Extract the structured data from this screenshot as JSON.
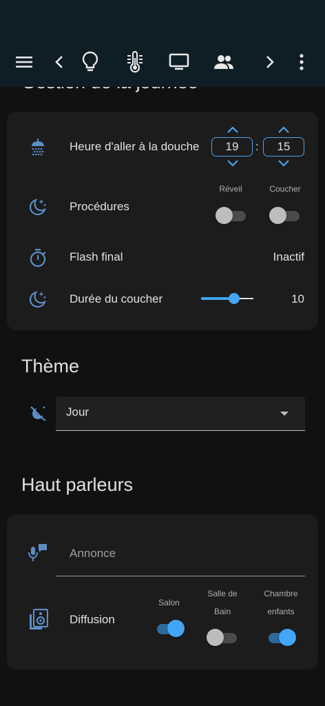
{
  "topbar": {
    "icons": [
      "menu-icon",
      "chevron-left-icon",
      "lightbulb-icon",
      "thermometer-icon",
      "monitor-icon",
      "people-icon",
      "chevron-right-icon",
      "more-vert-icon"
    ]
  },
  "sections": {
    "day": {
      "title_partial": "Gestion de la journée",
      "shower": {
        "icon": "shower-icon",
        "label": "Heure d'aller à la douche",
        "hour": "19",
        "minute": "15",
        "separator": ":"
      },
      "procedures": {
        "icon": "moon-stars-icon",
        "label": "Procédures",
        "switches": [
          {
            "label": "Réveil",
            "on": false
          },
          {
            "label": "Coucher",
            "on": false
          }
        ]
      },
      "flash": {
        "icon": "timer-icon",
        "label": "Flash final",
        "value": "Inactif"
      },
      "bedtime_duration": {
        "icon": "moon-stars-icon",
        "label": "Durée du coucher",
        "value": "10",
        "slider_fraction": 0.63
      }
    },
    "theme": {
      "title": "Thème",
      "icon": "theme-sun-moon-icon",
      "selected": "Jour"
    },
    "speakers": {
      "title": "Haut parleurs",
      "announce": {
        "icon": "microphone-message-icon",
        "placeholder": "Annonce"
      },
      "diffusion": {
        "icon": "speaker-icon",
        "label": "Diffusion",
        "switches": [
          {
            "label": "Salon",
            "on": true
          },
          {
            "label": "Salle de Bain",
            "on": false
          },
          {
            "label": "Chambre enfants",
            "on": true
          }
        ]
      }
    }
  },
  "colors": {
    "accent": "#42a5f5",
    "icon": "#5b8fc7",
    "card": "#1c1c1c",
    "background": "#111111",
    "topbar": "#0f1d24"
  }
}
